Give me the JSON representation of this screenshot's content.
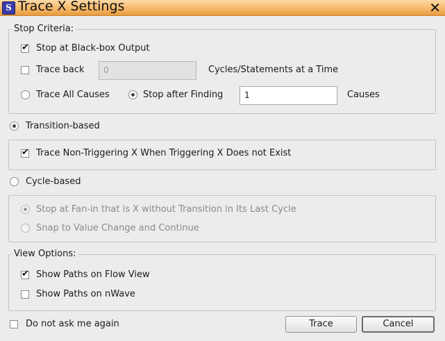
{
  "window": {
    "title": "Trace X Settings",
    "icon": "S"
  },
  "stop_criteria": {
    "title": "Stop Criteria:",
    "stop_at_blackbox": {
      "label": "Stop at Black-box Output",
      "checked": true
    },
    "trace_back": {
      "label": "Trace back",
      "checked": false,
      "value": "0",
      "suffix": "Cycles/Statements at a Time"
    },
    "trace_all_causes": {
      "label": "Trace All Causes",
      "selected": false
    },
    "stop_after_finding": {
      "label": "Stop after Finding",
      "selected": true,
      "value": "1",
      "suffix": "Causes"
    }
  },
  "transition_based": {
    "label": "Transition-based",
    "selected": true,
    "non_triggering": {
      "label": "Trace Non-Triggering X When Triggering X Does not Exist",
      "checked": true
    }
  },
  "cycle_based": {
    "label": "Cycle-based",
    "selected": false,
    "fan_in": {
      "label": "Stop at Fan-in that is X without Transition in Its Last Cycle",
      "selected": true
    },
    "snap": {
      "label": "Snap to Value Change and Continue",
      "selected": false
    }
  },
  "view_options": {
    "title": "View Options:",
    "flow_view": {
      "label": "Show Paths on Flow View",
      "checked": true
    },
    "nwave": {
      "label": "Show Paths on nWave",
      "checked": false
    }
  },
  "footer": {
    "do_not_ask": {
      "label": "Do not ask me again",
      "checked": false
    },
    "trace_button": "Trace",
    "cancel_button": "Cancel"
  }
}
